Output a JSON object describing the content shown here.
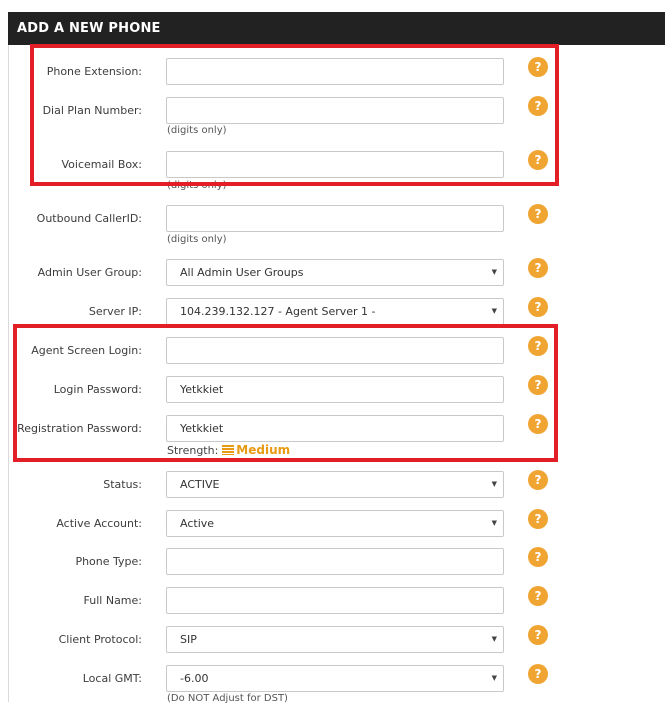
{
  "header": {
    "title": "ADD A NEW PHONE"
  },
  "help_glyph": "?",
  "fields": {
    "phone_extension": {
      "label": "Phone Extension:",
      "value": ""
    },
    "dial_plan_number": {
      "label": "Dial Plan Number:",
      "value": "",
      "hint": "(digits only)"
    },
    "voicemail_box": {
      "label": "Voicemail Box:",
      "value": "",
      "hint": "(digits only)"
    },
    "outbound_callerid": {
      "label": "Outbound CallerID:",
      "value": "",
      "hint": "(digits only)"
    },
    "admin_user_group": {
      "label": "Admin User Group:",
      "value": "All Admin User Groups"
    },
    "server_ip": {
      "label": "Server IP:",
      "value": "104.239.132.127 - Agent Server 1 -"
    },
    "agent_screen_login": {
      "label": "Agent Screen Login:",
      "value": ""
    },
    "login_password": {
      "label": "Login Password:",
      "value": "Yetkkiet"
    },
    "registration_password": {
      "label": "Registration Password:",
      "value": "Yetkkiet",
      "strength_label": "Strength:",
      "strength_value": "Medium"
    },
    "status": {
      "label": "Status:",
      "value": "ACTIVE"
    },
    "active_account": {
      "label": "Active Account:",
      "value": "Active"
    },
    "phone_type": {
      "label": "Phone Type:",
      "value": ""
    },
    "full_name": {
      "label": "Full Name:",
      "value": ""
    },
    "client_protocol": {
      "label": "Client Protocol:",
      "value": "SIP"
    },
    "local_gmt": {
      "label": "Local GMT:",
      "value": "-6.00",
      "hint": "(Do NOT Adjust for DST)"
    }
  },
  "colors": {
    "header_bg": "#222222",
    "help_icon": "#f0a532",
    "highlight_border": "#e21e26",
    "strength_medium": "#e89a12"
  },
  "icons": {
    "help": "question-mark-circle-icon",
    "dropdown": "caret-down-icon",
    "strength": "strength-bars-icon"
  }
}
